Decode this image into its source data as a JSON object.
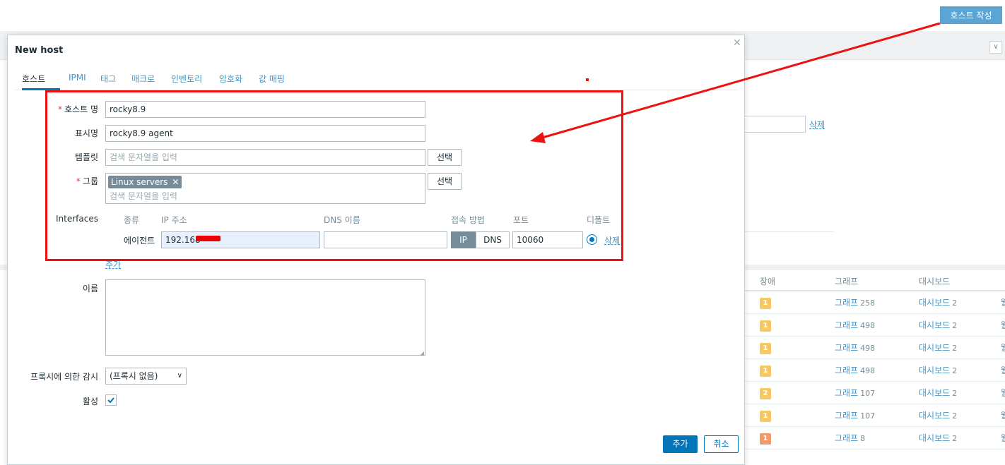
{
  "background": {
    "create_host_button": "호스트 작성",
    "filter_delete_link": "삭제",
    "table": {
      "headers": [
        "장애",
        "그래프",
        "대시보드"
      ],
      "rows": [
        {
          "problems": "1",
          "badge_color": "#f5c962",
          "graph_label": "그래프",
          "graph_count": "258",
          "dash_label": "대시보드",
          "dash_count": "2"
        },
        {
          "problems": "1",
          "badge_color": "#f5c962",
          "graph_label": "그래프",
          "graph_count": "498",
          "dash_label": "대시보드",
          "dash_count": "2"
        },
        {
          "problems": "1",
          "badge_color": "#f5c962",
          "graph_label": "그래프",
          "graph_count": "498",
          "dash_label": "대시보드",
          "dash_count": "2"
        },
        {
          "problems": "1",
          "badge_color": "#f5c962",
          "graph_label": "그래프",
          "graph_count": "498",
          "dash_label": "대시보드",
          "dash_count": "2"
        },
        {
          "problems": "2",
          "badge_color": "#f5c962",
          "graph_label": "그래프",
          "graph_count": "107",
          "dash_label": "대시보드",
          "dash_count": "2"
        },
        {
          "problems": "1",
          "badge_color": "#f5c962",
          "graph_label": "그래프",
          "graph_count": "107",
          "dash_label": "대시보드",
          "dash_count": "2"
        },
        {
          "problems": "1",
          "badge_color": "#f19a6b",
          "graph_label": "그래프",
          "graph_count": "8",
          "dash_label": "대시보드",
          "dash_count": "2"
        }
      ]
    }
  },
  "modal": {
    "title": "New host",
    "tabs": [
      "호스트",
      "IPMI",
      "태그",
      "매크로",
      "인벤토리",
      "암호화",
      "값 매핑"
    ],
    "fields": {
      "host_name_label": "호스트 명",
      "host_name_value": "rocky8.9",
      "visible_name_label": "표시명",
      "visible_name_value": "rocky8.9 agent",
      "templates_label": "템플릿",
      "templates_placeholder": "검색 문자열을 입력",
      "select_label": "선택",
      "groups_label": "그룹",
      "group_chip": "Linux servers",
      "groups_placeholder": "검색 문자열을 입력",
      "interfaces_label": "Interfaces",
      "interfaces_headers": {
        "type": "종류",
        "ip": "IP 주소",
        "dns": "DNS 이름",
        "connect": "접속 방법",
        "port": "포트",
        "default": "디폴트"
      },
      "interface_row": {
        "type": "에이전트",
        "ip": "192.168",
        "dns": "",
        "connect_ip": "IP",
        "connect_dns": "DNS",
        "port": "10060",
        "remove": "삭제"
      },
      "add_interface": "추가",
      "description_label": "이름",
      "proxy_label": "프록시에 의한 감시",
      "proxy_value": "(프록시 없음)",
      "enabled_label": "활성",
      "enabled": true
    },
    "buttons": {
      "add": "추가",
      "cancel": "취소"
    }
  },
  "colors": {
    "primary": "#0275b8",
    "link": "#4796c4",
    "annotation": "#ee1111"
  }
}
